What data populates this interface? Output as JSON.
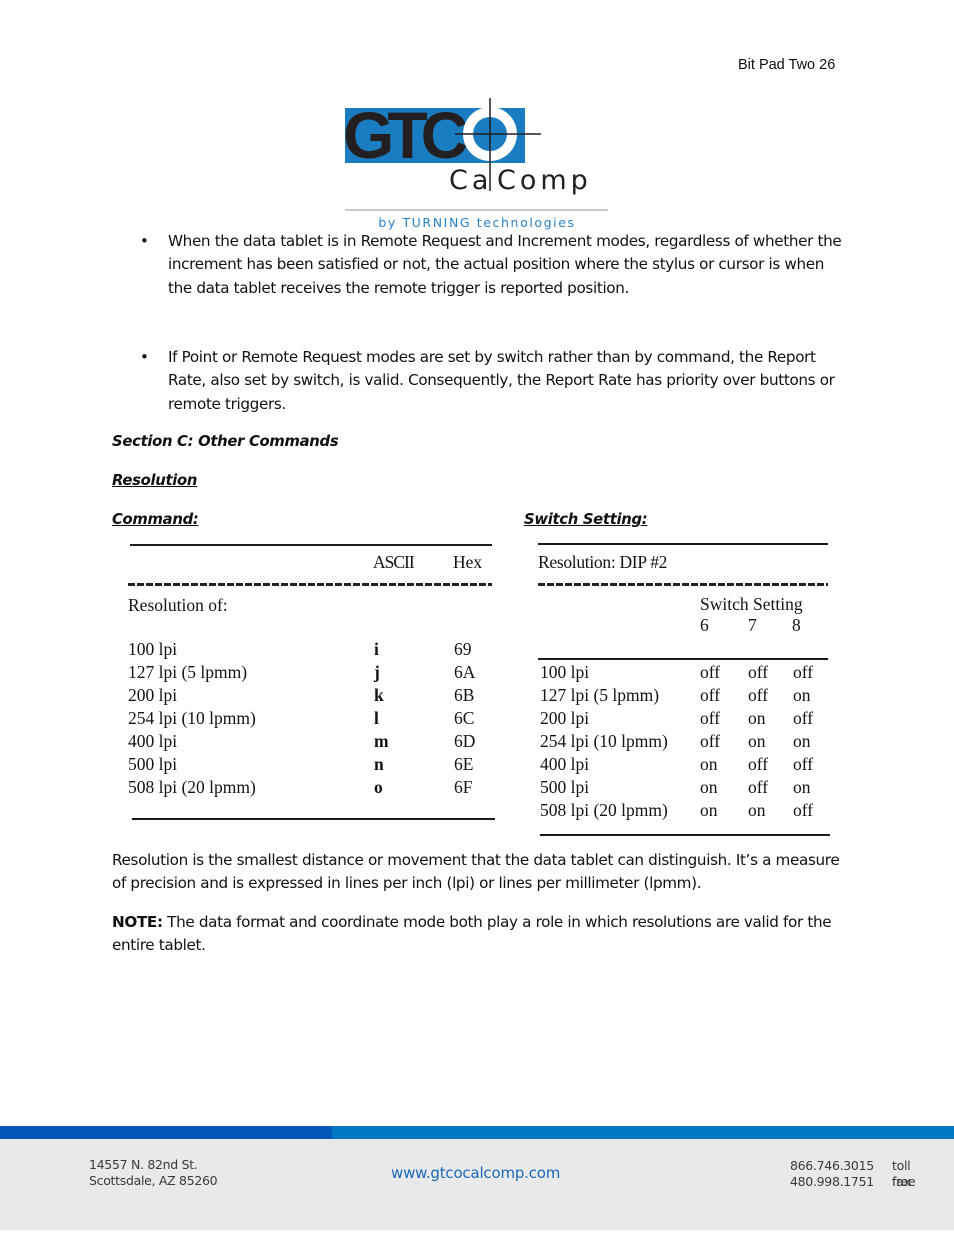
{
  "header": {
    "page_label": "Bit Pad Two 26"
  },
  "logo": {
    "letters": "GTC",
    "subtitle": "CalComp",
    "subtitle_left": "Ca",
    "subtitle_right": "Comp",
    "tagline": "by TURNING technologies",
    "colors": {
      "blue": "#1a7cc1",
      "black": "#231f20",
      "tagline": "#2a82c7"
    }
  },
  "bullets": [
    {
      "text": "When the data tablet is in Remote Request and Increment modes, regardless of whether the increment has been satisfied or not, the actual position where the stylus or cursor is when the data tablet receives the remote trigger is reported position."
    },
    {
      "text": "If Point or Remote Request modes are set by switch rather than by command, the Report Rate, also set by switch, is valid.  Consequently, the Report Rate has priority over buttons or remote triggers."
    }
  ],
  "section_heading": "Section C: Other Commands",
  "subsection_heading": "Resolution",
  "command_label": "Command:",
  "switch_label": "Switch Setting:",
  "command_table": {
    "headers": [
      "",
      "ASCII",
      "Hex"
    ],
    "group_label": "Resolution of:",
    "rows": [
      {
        "resolution": "100 lpi",
        "ascii": "i",
        "hex": "69"
      },
      {
        "resolution": "127 lpi (5 lpmm)",
        "ascii": "j",
        "hex": "6A"
      },
      {
        "resolution": "200 lpi",
        "ascii": "k",
        "hex": "6B"
      },
      {
        "resolution": "254 lpi (10 lpmm)",
        "ascii": "l",
        "hex": "6C"
      },
      {
        "resolution": "400 lpi",
        "ascii": "m",
        "hex": "6D"
      },
      {
        "resolution": "500 lpi",
        "ascii": "n",
        "hex": "6E"
      },
      {
        "resolution": "508 lpi (20 lpmm)",
        "ascii": "o",
        "hex": "6F"
      }
    ]
  },
  "switch_table": {
    "title": "Resolution:  DIP #2",
    "header": "Switch Setting",
    "switch_numbers": [
      "6",
      "7",
      "8"
    ],
    "rows": [
      {
        "resolution": "100 lpi",
        "s6": "off",
        "s7": "off",
        "s8": "off"
      },
      {
        "resolution": "127 lpi (5 lpmm)",
        "s6": "off",
        "s7": "off",
        "s8": "on"
      },
      {
        "resolution": "200 lpi",
        "s6": "off",
        "s7": "on",
        "s8": "off"
      },
      {
        "resolution": "254 lpi (10 lpmm)",
        "s6": "off",
        "s7": "on",
        "s8": "on"
      },
      {
        "resolution": "400 lpi",
        "s6": "on",
        "s7": "off",
        "s8": "off"
      },
      {
        "resolution": "500 lpi",
        "s6": "on",
        "s7": "off",
        "s8": "on"
      },
      {
        "resolution": "508 lpi (20 lpmm)",
        "s6": "on",
        "s7": "on",
        "s8": "off"
      }
    ]
  },
  "paragraphs": {
    "definition": "Resolution is the smallest distance or movement that the data tablet can distinguish.  It’s a measure of precision and is expressed in lines per inch (lpi) or lines per millimeter (lpmm).",
    "note_label": "NOTE:",
    "note_text": " The data format and coordinate mode both play a role in which resolutions are valid for the entire tablet."
  },
  "footer": {
    "address_line1": "14557 N. 82nd St.",
    "address_line2": "Scottsdale, AZ 85260",
    "website": "www.gtcocalcomp.com",
    "phone1": "866.746.3015",
    "phone1_label": "toll free",
    "phone2": "480.998.1751",
    "phone2_label": "fax",
    "colors": {
      "bar_dark": "#0057b8",
      "bar_light": "#0077c0",
      "background": "#e8e9eb"
    }
  }
}
